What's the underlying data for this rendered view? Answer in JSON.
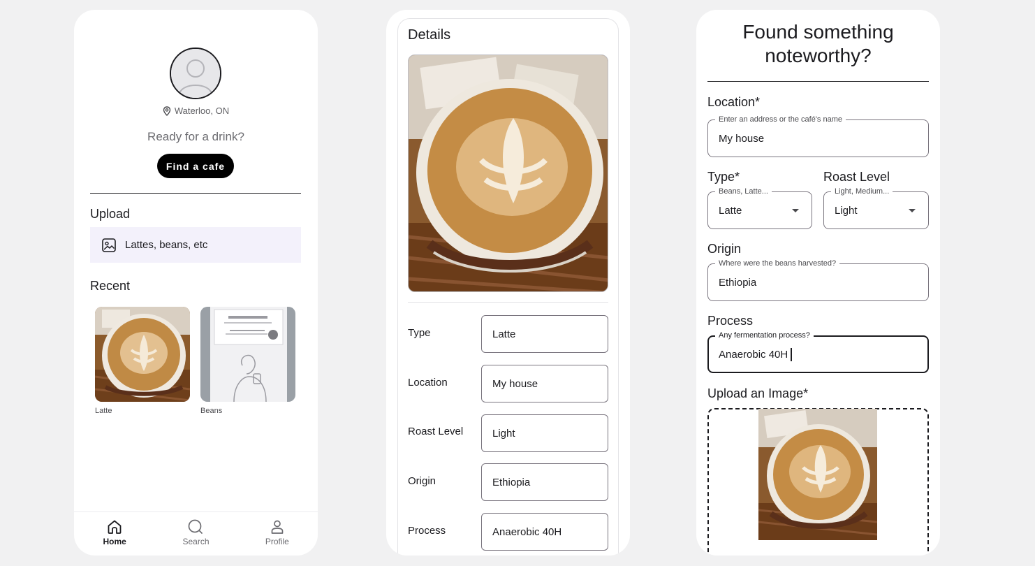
{
  "home": {
    "location": "Waterloo, ON",
    "greeting": "Ready for a drink?",
    "find_button": "Find a cafe",
    "upload_title": "Upload",
    "upload_hint": "Lattes, beans, etc",
    "recent_title": "Recent",
    "recent": [
      {
        "label": "Latte"
      },
      {
        "label": "Beans"
      }
    ],
    "nav": [
      {
        "label": "Home",
        "icon": "home-icon",
        "active": true
      },
      {
        "label": "Search",
        "icon": "search-icon",
        "active": false
      },
      {
        "label": "Profile",
        "icon": "profile-icon",
        "active": false
      }
    ]
  },
  "details": {
    "title": "Details",
    "rows": [
      {
        "label": "Type",
        "value": "Latte"
      },
      {
        "label": "Location",
        "value": "My house"
      },
      {
        "label": "Roast Level",
        "value": "Light"
      },
      {
        "label": "Origin",
        "value": "Ethiopia"
      },
      {
        "label": "Process",
        "value": "Anaerobic 40H"
      }
    ]
  },
  "form": {
    "title": "Found something noteworthy?",
    "location": {
      "label": "Location*",
      "hint": "Enter an address or the café's name",
      "value": "My house"
    },
    "type": {
      "label": "Type*",
      "hint": "Beans, Latte...",
      "value": "Latte"
    },
    "roast": {
      "label": "Roast Level",
      "hint": "Light, Medium...",
      "value": "Light"
    },
    "origin": {
      "label": "Origin",
      "hint": "Where were the beans harvested?",
      "value": "Ethiopia"
    },
    "process": {
      "label": "Process",
      "hint": "Any fermentation process?",
      "value": "Anaerobic 40H"
    },
    "upload": {
      "label": "Upload an Image*"
    }
  },
  "colors": {
    "accent": "#000000",
    "upload_bg": "#f3f1fb",
    "outline": "#79747e"
  }
}
